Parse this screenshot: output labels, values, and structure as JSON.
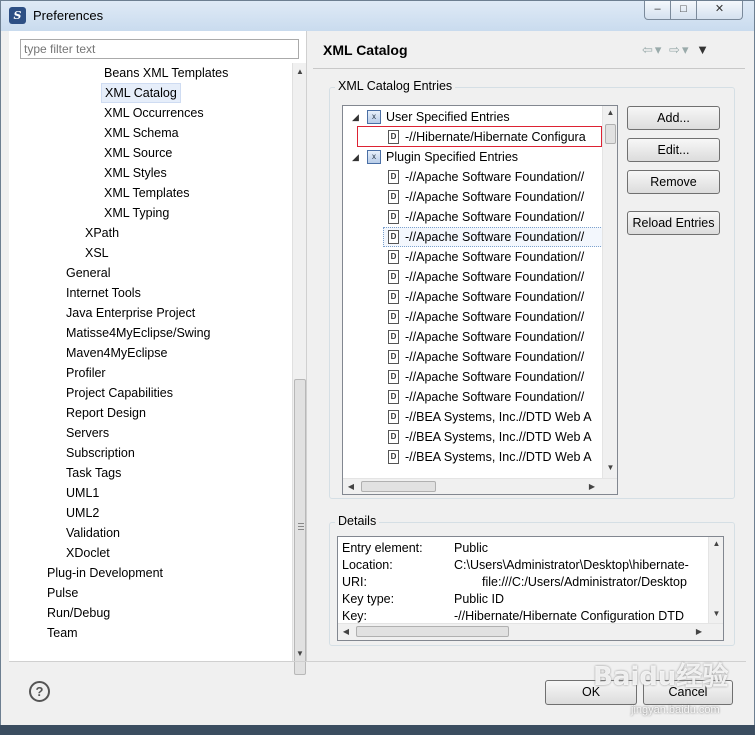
{
  "window": {
    "title": "Preferences"
  },
  "filter": {
    "placeholder": "type filter text"
  },
  "tree": [
    {
      "label": "Beans XML Templates",
      "indent": 3
    },
    {
      "label": "XML Catalog",
      "indent": 3,
      "selected": true
    },
    {
      "label": "XML Occurrences",
      "indent": 3
    },
    {
      "label": "XML Schema",
      "indent": 3
    },
    {
      "label": "XML Source",
      "indent": 3
    },
    {
      "label": "XML Styles",
      "indent": 3
    },
    {
      "label": "XML Templates",
      "indent": 3
    },
    {
      "label": "XML Typing",
      "indent": 3
    },
    {
      "label": "XPath",
      "indent": 2
    },
    {
      "label": "XSL",
      "indent": 2
    },
    {
      "label": "General",
      "indent": 1
    },
    {
      "label": "Internet Tools",
      "indent": 1
    },
    {
      "label": "Java Enterprise Project",
      "indent": 1
    },
    {
      "label": "Matisse4MyEclipse/Swing",
      "indent": 1
    },
    {
      "label": "Maven4MyEclipse",
      "indent": 1
    },
    {
      "label": "Profiler",
      "indent": 1
    },
    {
      "label": "Project Capabilities",
      "indent": 1
    },
    {
      "label": "Report Design",
      "indent": 1
    },
    {
      "label": "Servers",
      "indent": 1
    },
    {
      "label": "Subscription",
      "indent": 1
    },
    {
      "label": "Task Tags",
      "indent": 1
    },
    {
      "label": "UML1",
      "indent": 1
    },
    {
      "label": "UML2",
      "indent": 1
    },
    {
      "label": "Validation",
      "indent": 1
    },
    {
      "label": "XDoclet",
      "indent": 1
    },
    {
      "label": "Plug-in Development",
      "indent": 0
    },
    {
      "label": "Pulse",
      "indent": 0
    },
    {
      "label": "Run/Debug",
      "indent": 0
    },
    {
      "label": "Team",
      "indent": 0
    }
  ],
  "page": {
    "title": "XML Catalog"
  },
  "catalog": {
    "group_label": "XML Catalog Entries",
    "user_label": "User Specified Entries",
    "user_entry": "-//Hibernate/Hibernate Configura",
    "plugin_label": "Plugin Specified Entries",
    "plugin_entries": [
      "-//Apache Software Foundation//",
      "-//Apache Software Foundation//",
      "-//Apache Software Foundation//",
      "-//Apache Software Foundation//",
      "-//Apache Software Foundation//",
      "-//Apache Software Foundation//",
      "-//Apache Software Foundation//",
      "-//Apache Software Foundation//",
      "-//Apache Software Foundation//",
      "-//Apache Software Foundation//",
      "-//Apache Software Foundation//",
      "-//Apache Software Foundation//",
      "-//BEA Systems, Inc.//DTD Web A",
      "-//BEA Systems, Inc.//DTD Web A",
      "-//BEA Systems, Inc.//DTD Web A"
    ]
  },
  "buttons": {
    "add": "Add...",
    "edit": "Edit...",
    "remove": "Remove",
    "reload": "Reload Entries",
    "ok": "OK",
    "cancel": "Cancel"
  },
  "details": {
    "group_label": "Details",
    "rows": [
      {
        "key": "Entry element:",
        "value": "Public"
      },
      {
        "key": "Location:",
        "value": "C:\\Users\\Administrator\\Desktop\\hibernate-"
      },
      {
        "key": "URI:",
        "value": "file:///C:/Users/Administrator/Desktop"
      },
      {
        "key": "Key type:",
        "value": "Public ID"
      },
      {
        "key": "Key:",
        "value": "-//Hibernate/Hibernate Configuration DTD"
      }
    ]
  },
  "watermark": {
    "main": "Baidu经验",
    "sub": "jingyan.baidu.com"
  }
}
